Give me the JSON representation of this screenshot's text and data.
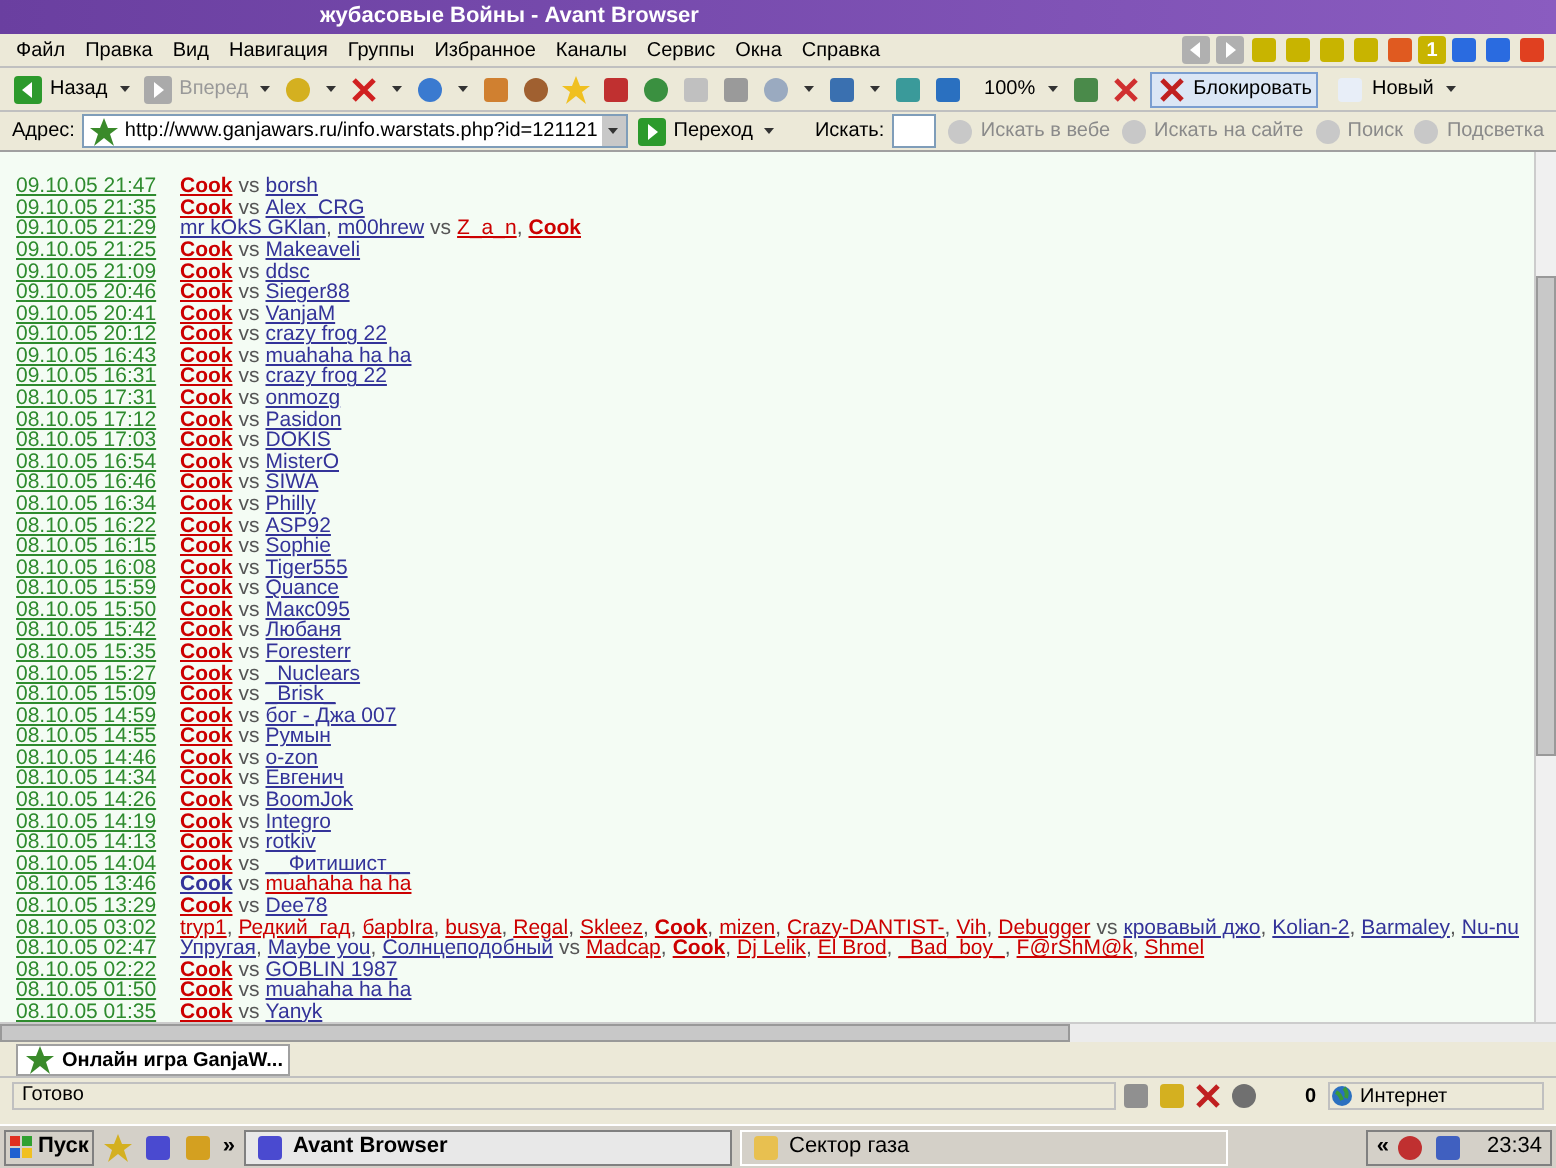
{
  "window": {
    "title": "жубасовые Войны - Avant Browser",
    "tab_count": "1"
  },
  "menu": [
    "Файл",
    "Правка",
    "Вид",
    "Навигация",
    "Группы",
    "Избранное",
    "Каналы",
    "Сервис",
    "Окна",
    "Справка"
  ],
  "toolbar": {
    "back": {
      "label": "Назад",
      "disabled": false
    },
    "forward": {
      "label": "Вперед",
      "disabled": true
    },
    "zoom": "100%",
    "block": {
      "label": "Блокировать",
      "selected": true
    },
    "new": "Новый"
  },
  "address": {
    "label": "Адрес:",
    "value": "http://www.ganjawars.ru/info.warstats.php?id=121121",
    "go": "Переход"
  },
  "search": {
    "label": "Искать:",
    "buttons": [
      {
        "label": "Искать в вебе",
        "disabled": true
      },
      {
        "label": "Искать на сайте",
        "disabled": true
      },
      {
        "label": "Поиск",
        "disabled": true
      },
      {
        "label": "Подсветка",
        "disabled": true
      }
    ]
  },
  "battles": [
    {
      "time": "09.10.05 21:47",
      "sep": "vs",
      "sides": [
        {
          "color": "#cc0000",
          "players": [
            {
              "name": "Cook",
              "bold": true
            }
          ]
        },
        {
          "color": "#333399",
          "players": [
            {
              "name": "borsh",
              "bold": false
            }
          ]
        }
      ]
    },
    {
      "time": "09.10.05 21:35",
      "sep": "vs",
      "sides": [
        {
          "color": "#cc0000",
          "players": [
            {
              "name": "Cook",
              "bold": true
            }
          ]
        },
        {
          "color": "#333399",
          "players": [
            {
              "name": "Alex_CRG",
              "bold": false
            }
          ]
        }
      ]
    },
    {
      "time": "09.10.05 21:29",
      "sep": "vs",
      "sides": [
        {
          "color": "#333399",
          "players": [
            {
              "name": "mr kOkS GKlan",
              "bold": false,
              "after": ","
            },
            {
              "name": "m00hrew",
              "bold": false
            }
          ]
        },
        {
          "color": "#cc0000",
          "players": [
            {
              "name": "Z_a_n",
              "bold": false,
              "after": ","
            },
            {
              "name": "Cook",
              "bold": true
            }
          ]
        }
      ]
    },
    {
      "time": "09.10.05 21:25",
      "sep": "vs",
      "sides": [
        {
          "color": "#cc0000",
          "players": [
            {
              "name": "Cook",
              "bold": true
            }
          ]
        },
        {
          "color": "#333399",
          "players": [
            {
              "name": "Makeaveli",
              "bold": false
            }
          ]
        }
      ]
    },
    {
      "time": "09.10.05 21:09",
      "sep": "vs",
      "sides": [
        {
          "color": "#cc0000",
          "players": [
            {
              "name": "Cook",
              "bold": true
            }
          ]
        },
        {
          "color": "#333399",
          "players": [
            {
              "name": "ddsc",
              "bold": false
            }
          ]
        }
      ]
    },
    {
      "time": "09.10.05 20:46",
      "sep": "vs",
      "sides": [
        {
          "color": "#cc0000",
          "players": [
            {
              "name": "Cook",
              "bold": true
            }
          ]
        },
        {
          "color": "#333399",
          "players": [
            {
              "name": "Sieger88",
              "bold": false
            }
          ]
        }
      ]
    },
    {
      "time": "09.10.05 20:41",
      "sep": "vs",
      "sides": [
        {
          "color": "#cc0000",
          "players": [
            {
              "name": "Cook",
              "bold": true
            }
          ]
        },
        {
          "color": "#333399",
          "players": [
            {
              "name": "VanjaM",
              "bold": false
            }
          ]
        }
      ]
    },
    {
      "time": "09.10.05 20:12",
      "sep": "vs",
      "sides": [
        {
          "color": "#cc0000",
          "players": [
            {
              "name": "Cook",
              "bold": true
            }
          ]
        },
        {
          "color": "#333399",
          "players": [
            {
              "name": "crazy frog 22",
              "bold": false
            }
          ]
        }
      ]
    },
    {
      "time": "09.10.05 16:43",
      "sep": "vs",
      "sides": [
        {
          "color": "#cc0000",
          "players": [
            {
              "name": "Cook",
              "bold": true
            }
          ]
        },
        {
          "color": "#333399",
          "players": [
            {
              "name": "muahaha ha ha",
              "bold": false
            }
          ]
        }
      ]
    },
    {
      "time": "09.10.05 16:31",
      "sep": "vs",
      "sides": [
        {
          "color": "#cc0000",
          "players": [
            {
              "name": "Cook",
              "bold": true
            }
          ]
        },
        {
          "color": "#333399",
          "players": [
            {
              "name": "crazy frog 22",
              "bold": false
            }
          ]
        }
      ]
    },
    {
      "time": "08.10.05 17:31",
      "sep": "vs",
      "sides": [
        {
          "color": "#cc0000",
          "players": [
            {
              "name": "Cook",
              "bold": true
            }
          ]
        },
        {
          "color": "#333399",
          "players": [
            {
              "name": "onmozg",
              "bold": false
            }
          ]
        }
      ]
    },
    {
      "time": "08.10.05 17:12",
      "sep": "vs",
      "sides": [
        {
          "color": "#cc0000",
          "players": [
            {
              "name": "Cook",
              "bold": true
            }
          ]
        },
        {
          "color": "#333399",
          "players": [
            {
              "name": "Pasidon",
              "bold": false
            }
          ]
        }
      ]
    },
    {
      "time": "08.10.05 17:03",
      "sep": "vs",
      "sides": [
        {
          "color": "#cc0000",
          "players": [
            {
              "name": "Cook",
              "bold": true
            }
          ]
        },
        {
          "color": "#333399",
          "players": [
            {
              "name": "DOKIS",
              "bold": false
            }
          ]
        }
      ]
    },
    {
      "time": "08.10.05 16:54",
      "sep": "vs",
      "sides": [
        {
          "color": "#cc0000",
          "players": [
            {
              "name": "Cook",
              "bold": true
            }
          ]
        },
        {
          "color": "#333399",
          "players": [
            {
              "name": "MisterO",
              "bold": false
            }
          ]
        }
      ]
    },
    {
      "time": "08.10.05 16:46",
      "sep": "vs",
      "sides": [
        {
          "color": "#cc0000",
          "players": [
            {
              "name": "Cook",
              "bold": true
            }
          ]
        },
        {
          "color": "#333399",
          "players": [
            {
              "name": "SIWA",
              "bold": false
            }
          ]
        }
      ]
    },
    {
      "time": "08.10.05 16:34",
      "sep": "vs",
      "sides": [
        {
          "color": "#cc0000",
          "players": [
            {
              "name": "Cook",
              "bold": true
            }
          ]
        },
        {
          "color": "#333399",
          "players": [
            {
              "name": "Philly",
              "bold": false
            }
          ]
        }
      ]
    },
    {
      "time": "08.10.05 16:22",
      "sep": "vs",
      "sides": [
        {
          "color": "#cc0000",
          "players": [
            {
              "name": "Cook",
              "bold": true
            }
          ]
        },
        {
          "color": "#333399",
          "players": [
            {
              "name": "ASP92",
              "bold": false
            }
          ]
        }
      ]
    },
    {
      "time": "08.10.05 16:15",
      "sep": "vs",
      "sides": [
        {
          "color": "#cc0000",
          "players": [
            {
              "name": "Cook",
              "bold": true
            }
          ]
        },
        {
          "color": "#333399",
          "players": [
            {
              "name": "Sophie",
              "bold": false
            }
          ]
        }
      ]
    },
    {
      "time": "08.10.05 16:08",
      "sep": "vs",
      "sides": [
        {
          "color": "#cc0000",
          "players": [
            {
              "name": "Cook",
              "bold": true
            }
          ]
        },
        {
          "color": "#333399",
          "players": [
            {
              "name": "Tiger555",
              "bold": false
            }
          ]
        }
      ]
    },
    {
      "time": "08.10.05 15:59",
      "sep": "vs",
      "sides": [
        {
          "color": "#cc0000",
          "players": [
            {
              "name": "Cook",
              "bold": true
            }
          ]
        },
        {
          "color": "#333399",
          "players": [
            {
              "name": "Quance",
              "bold": false
            }
          ]
        }
      ]
    },
    {
      "time": "08.10.05 15:50",
      "sep": "vs",
      "sides": [
        {
          "color": "#cc0000",
          "players": [
            {
              "name": "Cook",
              "bold": true
            }
          ]
        },
        {
          "color": "#333399",
          "players": [
            {
              "name": "Макс095",
              "bold": false
            }
          ]
        }
      ]
    },
    {
      "time": "08.10.05 15:42",
      "sep": "vs",
      "sides": [
        {
          "color": "#cc0000",
          "players": [
            {
              "name": "Cook",
              "bold": true
            }
          ]
        },
        {
          "color": "#333399",
          "players": [
            {
              "name": "Любаня",
              "bold": false
            }
          ]
        }
      ]
    },
    {
      "time": "08.10.05 15:35",
      "sep": "vs",
      "sides": [
        {
          "color": "#cc0000",
          "players": [
            {
              "name": "Cook",
              "bold": true
            }
          ]
        },
        {
          "color": "#333399",
          "players": [
            {
              "name": "Foresterr",
              "bold": false
            }
          ]
        }
      ]
    },
    {
      "time": "08.10.05 15:27",
      "sep": "vs",
      "sides": [
        {
          "color": "#cc0000",
          "players": [
            {
              "name": "Cook",
              "bold": true
            }
          ]
        },
        {
          "color": "#333399",
          "players": [
            {
              "name": "_Nuclears",
              "bold": false
            }
          ]
        }
      ]
    },
    {
      "time": "08.10.05 15:09",
      "sep": "vs",
      "sides": [
        {
          "color": "#cc0000",
          "players": [
            {
              "name": "Cook",
              "bold": true
            }
          ]
        },
        {
          "color": "#333399",
          "players": [
            {
              "name": "_Brisk_",
              "bold": false
            }
          ]
        }
      ]
    },
    {
      "time": "08.10.05 14:59",
      "sep": "vs",
      "sides": [
        {
          "color": "#cc0000",
          "players": [
            {
              "name": "Cook",
              "bold": true
            }
          ]
        },
        {
          "color": "#333399",
          "players": [
            {
              "name": "бог - Джа 007",
              "bold": false
            }
          ]
        }
      ]
    },
    {
      "time": "08.10.05 14:55",
      "sep": "vs",
      "sides": [
        {
          "color": "#cc0000",
          "players": [
            {
              "name": "Cook",
              "bold": true
            }
          ]
        },
        {
          "color": "#333399",
          "players": [
            {
              "name": "Румын",
              "bold": false
            }
          ]
        }
      ]
    },
    {
      "time": "08.10.05 14:46",
      "sep": "vs",
      "sides": [
        {
          "color": "#cc0000",
          "players": [
            {
              "name": "Cook",
              "bold": true
            }
          ]
        },
        {
          "color": "#333399",
          "players": [
            {
              "name": "o-zon",
              "bold": false
            }
          ]
        }
      ]
    },
    {
      "time": "08.10.05 14:34",
      "sep": "vs",
      "sides": [
        {
          "color": "#cc0000",
          "players": [
            {
              "name": "Cook",
              "bold": true
            }
          ]
        },
        {
          "color": "#333399",
          "players": [
            {
              "name": "Евгенич",
              "bold": false
            }
          ]
        }
      ]
    },
    {
      "time": "08.10.05 14:26",
      "sep": "vs",
      "sides": [
        {
          "color": "#cc0000",
          "players": [
            {
              "name": "Cook",
              "bold": true
            }
          ]
        },
        {
          "color": "#333399",
          "players": [
            {
              "name": "BoomJok",
              "bold": false
            }
          ]
        }
      ]
    },
    {
      "time": "08.10.05 14:19",
      "sep": "vs",
      "sides": [
        {
          "color": "#cc0000",
          "players": [
            {
              "name": "Cook",
              "bold": true
            }
          ]
        },
        {
          "color": "#333399",
          "players": [
            {
              "name": "Integro",
              "bold": false
            }
          ]
        }
      ]
    },
    {
      "time": "08.10.05 14:13",
      "sep": "vs",
      "sides": [
        {
          "color": "#cc0000",
          "players": [
            {
              "name": "Cook",
              "bold": true
            }
          ]
        },
        {
          "color": "#333399",
          "players": [
            {
              "name": "rotkiv",
              "bold": false
            }
          ]
        }
      ]
    },
    {
      "time": "08.10.05 14:04",
      "sep": "vs",
      "sides": [
        {
          "color": "#cc0000",
          "players": [
            {
              "name": "Cook",
              "bold": true
            }
          ]
        },
        {
          "color": "#333399",
          "players": [
            {
              "name": "__Фитишист__",
              "bold": false
            }
          ]
        }
      ]
    },
    {
      "time": "08.10.05 13:46",
      "sep": "vs",
      "sides": [
        {
          "color": "#333399",
          "players": [
            {
              "name": "Cook",
              "bold": true
            }
          ]
        },
        {
          "color": "#cc0000",
          "players": [
            {
              "name": "muahaha ha ha",
              "bold": false
            }
          ]
        }
      ]
    },
    {
      "time": "08.10.05 13:29",
      "sep": "vs",
      "sides": [
        {
          "color": "#cc0000",
          "players": [
            {
              "name": "Cook",
              "bold": true
            }
          ]
        },
        {
          "color": "#333399",
          "players": [
            {
              "name": "Dee78",
              "bold": false
            }
          ]
        }
      ]
    },
    {
      "time": "08.10.05 03:02",
      "sep": "vs",
      "sides": [
        {
          "color": "#cc0000",
          "players": [
            {
              "name": "tryp1",
              "bold": false,
              "after": ","
            },
            {
              "name": "Редкий_гад",
              "bold": false,
              "after": ","
            },
            {
              "name": "барbIra",
              "bold": false,
              "after": ","
            },
            {
              "name": "busya",
              "bold": false,
              "after": ","
            },
            {
              "name": "Regal",
              "bold": false,
              "after": ","
            },
            {
              "name": "Skleez",
              "bold": false,
              "after": ","
            },
            {
              "name": "Cook",
              "bold": true,
              "after": ","
            },
            {
              "name": "mizen",
              "bold": false,
              "after": ","
            },
            {
              "name": "Crazy-DANTIST-",
              "bold": false,
              "after": ","
            },
            {
              "name": "Vih",
              "bold": false,
              "after": ","
            },
            {
              "name": "Debugger",
              "bold": false
            }
          ]
        },
        {
          "color": "#333399",
          "players": [
            {
              "name": "кровавый джо",
              "bold": false,
              "after": ","
            },
            {
              "name": "Kolian-2",
              "bold": false,
              "after": ","
            },
            {
              "name": "Barmaley",
              "bold": false,
              "after": ","
            },
            {
              "name": "Nu-nu",
              "bold": false
            }
          ]
        }
      ]
    },
    {
      "time": "08.10.05 02:47",
      "sep": "vs",
      "sides": [
        {
          "color": "#333399",
          "players": [
            {
              "name": "Упругая",
              "bold": false,
              "after": ","
            },
            {
              "name": "Maybe you",
              "bold": false,
              "after": ","
            },
            {
              "name": "Солнцеподобный",
              "bold": false
            }
          ]
        },
        {
          "color": "#cc0000",
          "players": [
            {
              "name": "Madcap",
              "bold": false,
              "after": ","
            },
            {
              "name": "Cook",
              "bold": true,
              "after": ","
            },
            {
              "name": "Dj Lelik",
              "bold": false,
              "after": ","
            },
            {
              "name": "El Brod",
              "bold": false,
              "after": ","
            },
            {
              "name": "_Bad_boy_",
              "bold": false,
              "after": ","
            },
            {
              "name": "F@rShM@k",
              "bold": false,
              "after": ","
            },
            {
              "name": "Shmel",
              "bold": false
            }
          ]
        }
      ]
    },
    {
      "time": "08.10.05 02:22",
      "sep": "vs",
      "sides": [
        {
          "color": "#cc0000",
          "players": [
            {
              "name": "Cook",
              "bold": true
            }
          ]
        },
        {
          "color": "#333399",
          "players": [
            {
              "name": "GOBLIN 1987",
              "bold": false
            }
          ]
        }
      ]
    },
    {
      "time": "08.10.05 01:50",
      "sep": "vs",
      "sides": [
        {
          "color": "#cc0000",
          "players": [
            {
              "name": "Cook",
              "bold": true
            }
          ]
        },
        {
          "color": "#333399",
          "players": [
            {
              "name": "muahaha ha ha",
              "bold": false
            }
          ]
        }
      ]
    },
    {
      "time": "08.10.05 01:35",
      "sep": "vs",
      "sides": [
        {
          "color": "#cc0000",
          "players": [
            {
              "name": "Cook",
              "bold": true
            }
          ]
        },
        {
          "color": "#333399",
          "players": [
            {
              "name": "Yanyk",
              "bold": false
            }
          ]
        }
      ]
    }
  ],
  "tabs": [
    {
      "label": "Онлайн игра GanjaW...",
      "selected": true
    }
  ],
  "status": {
    "text": "Готово",
    "count": "0",
    "zone": "Интернет"
  },
  "taskbar": {
    "start": "Пуск",
    "more": "»",
    "tasks": [
      {
        "label": "Avant Browser",
        "selected": true
      },
      {
        "label": "Сектор газа",
        "selected": false
      }
    ],
    "tray_more": "«",
    "clock": "23:34"
  }
}
